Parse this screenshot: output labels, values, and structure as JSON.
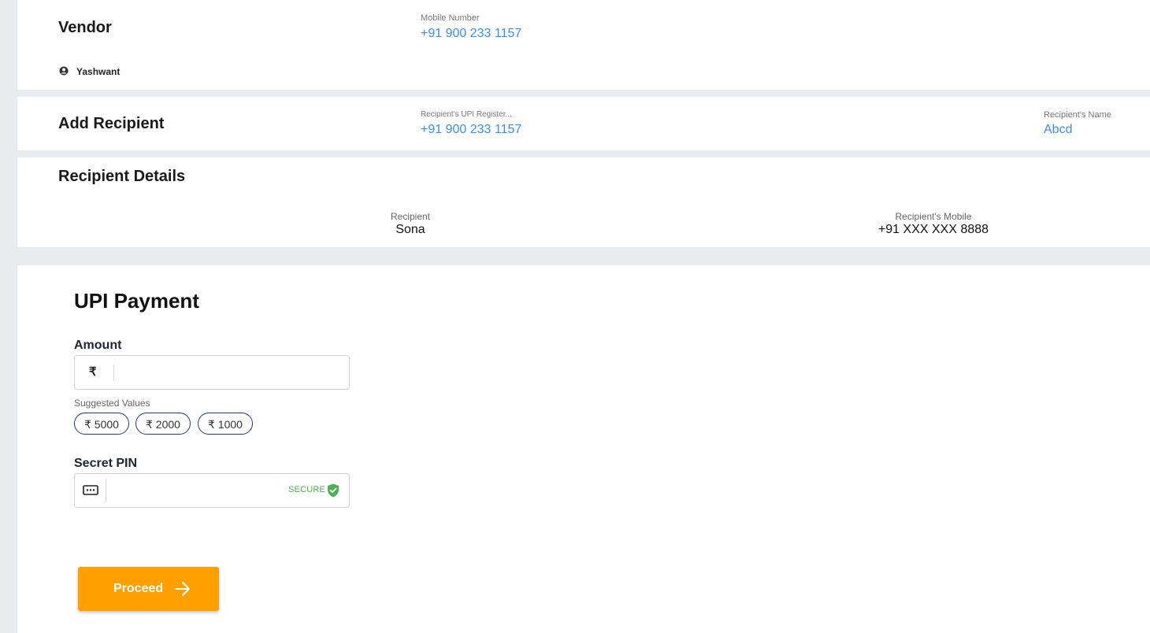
{
  "vendor": {
    "title": "Vendor",
    "mobile_label": "Mobile Number",
    "mobile_value": "+91 900 233 1157",
    "user_name": "Yashwant"
  },
  "add_recipient": {
    "title": "Add Recipient",
    "upi_label": "Recipient's UPI Register...",
    "upi_value": "+91 900 233 1157",
    "name_label": "Recipient's Name",
    "name_value": "Abcd"
  },
  "recipient_details": {
    "title": "Recipient Details",
    "recipient_label": "Recipient",
    "recipient_value": "Sona",
    "mobile_label": "Recipient's Mobile",
    "mobile_value": "+91 XXX XXX 8888"
  },
  "payment": {
    "title": "UPI Payment",
    "amount_label": "Amount",
    "currency_symbol": "₹",
    "amount_value": "",
    "suggested_label": "Suggested Values",
    "suggestions": [
      "₹ 5000",
      "₹ 2000",
      "₹ 1000"
    ],
    "pin_label": "Secret PIN",
    "pin_value": "",
    "secure_text": "SECURE",
    "proceed_label": "Proceed"
  },
  "colors": {
    "accent_blue": "#3d8fe0",
    "proceed_orange": "#ffa000",
    "secure_green": "#4caf50",
    "chip_border": "#1f3a7a",
    "background": "#e8ecee"
  },
  "icons": {
    "user": "user-circle-icon",
    "keypad": "keypad-icon",
    "shield": "shield-check-icon",
    "arrow": "arrow-right-icon"
  }
}
